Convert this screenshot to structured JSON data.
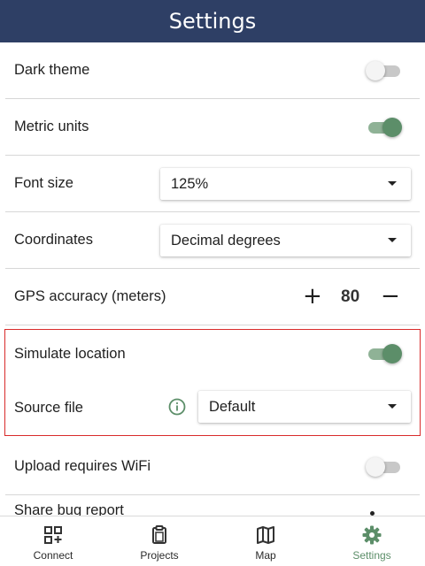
{
  "header": {
    "title": "Settings"
  },
  "settings": {
    "dark_theme": {
      "label": "Dark theme",
      "enabled": false
    },
    "metric_units": {
      "label": "Metric units",
      "enabled": true
    },
    "font_size": {
      "label": "Font size",
      "value": "125%"
    },
    "coordinates": {
      "label": "Coordinates",
      "value": "Decimal degrees"
    },
    "gps_accuracy": {
      "label": "GPS accuracy (meters)",
      "plus": "+",
      "value": "80",
      "minus": "−"
    },
    "simulate_location": {
      "label": "Simulate location",
      "enabled": true
    },
    "source_file": {
      "label": "Source file",
      "value": "Default"
    },
    "upload_wifi": {
      "label": "Upload requires WiFi",
      "enabled": false
    },
    "share_bug": {
      "label": "Share bug report"
    }
  },
  "nav": [
    {
      "label": "Connect",
      "icon": "connect-icon",
      "active": false
    },
    {
      "label": "Projects",
      "icon": "clipboard-icon",
      "active": false
    },
    {
      "label": "Map",
      "icon": "map-icon",
      "active": false
    },
    {
      "label": "Settings",
      "icon": "gear-icon",
      "active": true
    }
  ],
  "colors": {
    "header": "#2e3f65",
    "accent": "#5c8e69",
    "highlight": "#d92b2b"
  }
}
